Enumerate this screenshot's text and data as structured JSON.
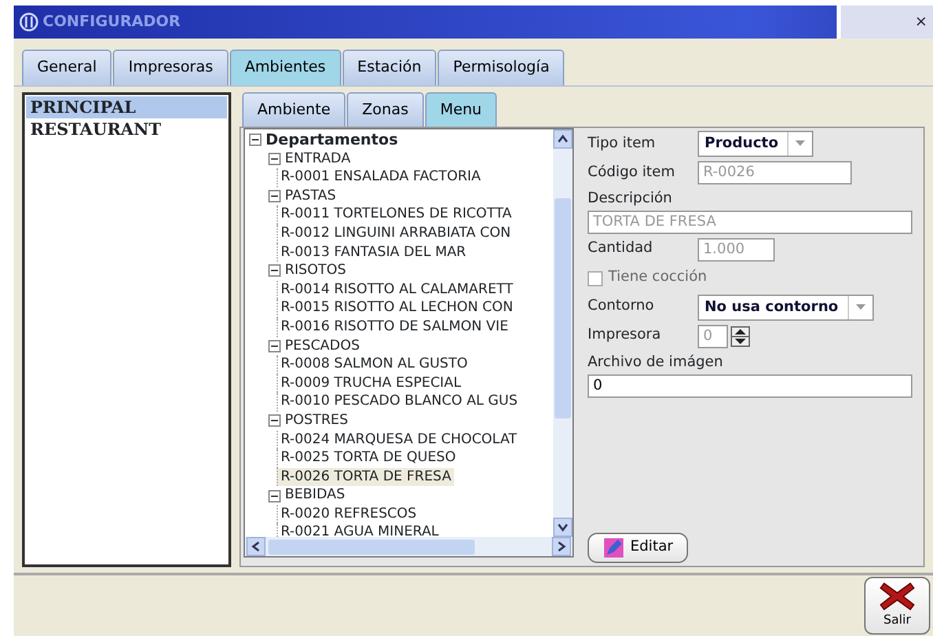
{
  "window": {
    "title": "CONFIGURADOR",
    "close": "×"
  },
  "tabs": [
    {
      "label": "General",
      "selected": false
    },
    {
      "label": "Impresoras",
      "selected": false
    },
    {
      "label": "Ambientes",
      "selected": true
    },
    {
      "label": "Estación",
      "selected": false
    },
    {
      "label": "Permisología",
      "selected": false
    }
  ],
  "ambientes": [
    {
      "label": "PRINCIPAL",
      "selected": true
    },
    {
      "label": "RESTAURANT",
      "selected": false
    }
  ],
  "subtabs": [
    {
      "label": "Ambiente",
      "selected": false
    },
    {
      "label": "Zonas",
      "selected": false
    },
    {
      "label": "Menu",
      "selected": true
    }
  ],
  "tree": {
    "label": "Departamentos",
    "expanded": true,
    "children": [
      {
        "label": "ENTRADA",
        "expanded": true,
        "children": [
          {
            "label": "R-0001 ENSALADA FACTORIA",
            "selected": false
          }
        ]
      },
      {
        "label": "PASTAS",
        "expanded": true,
        "children": [
          {
            "label": "R-0011 TORTELONES DE RICOTTA",
            "selected": false
          },
          {
            "label": "R-0012 LINGUINI ARRABIATA CON",
            "selected": false
          },
          {
            "label": "R-0013 FANTASIA DEL MAR",
            "selected": false
          }
        ]
      },
      {
        "label": "RISOTOS",
        "expanded": true,
        "children": [
          {
            "label": "R-0014 RISOTTO AL CALAMARETT",
            "selected": false
          },
          {
            "label": "R-0015 RISOTTO AL LECHON CON",
            "selected": false
          },
          {
            "label": "R-0016 RISOTTO DE SALMON VIE",
            "selected": false
          }
        ]
      },
      {
        "label": "PESCADOS",
        "expanded": true,
        "children": [
          {
            "label": "R-0008 SALMON AL GUSTO",
            "selected": false
          },
          {
            "label": "R-0009 TRUCHA ESPECIAL",
            "selected": false
          },
          {
            "label": "R-0010 PESCADO BLANCO AL GUS",
            "selected": false
          }
        ]
      },
      {
        "label": "POSTRES",
        "expanded": true,
        "children": [
          {
            "label": "R-0024 MARQUESA DE CHOCOLAT",
            "selected": false
          },
          {
            "label": "R-0025 TORTA DE QUESO",
            "selected": false
          },
          {
            "label": "R-0026 TORTA DE FRESA",
            "selected": true
          }
        ]
      },
      {
        "label": "BEBIDAS",
        "expanded": true,
        "children": [
          {
            "label": "R-0020 REFRESCOS",
            "selected": false
          },
          {
            "label": "R-0021 AGUA MINERAL",
            "selected": false
          }
        ]
      }
    ]
  },
  "form": [
    {
      "kind": "select",
      "label": "Tipo item",
      "value": "Producto"
    },
    {
      "kind": "text",
      "label": "Código item",
      "value": "R-0026",
      "disabled": true
    },
    {
      "kind": "stacked",
      "label": "Descripción",
      "value": "TORTA DE FRESA",
      "disabled": true
    },
    {
      "kind": "text",
      "label": "Cantidad",
      "value": "1.000",
      "disabled": true
    },
    {
      "kind": "checkbox",
      "label": "Tiene cocción",
      "checked": false,
      "disabled": true
    },
    {
      "kind": "select",
      "label": "Contorno",
      "value": "No usa contorno"
    },
    {
      "kind": "spin",
      "label": "Impresora",
      "value": "0",
      "disabled": true
    },
    {
      "kind": "stacked",
      "label": "Archivo de imágen",
      "value": "0",
      "disabled": false
    }
  ],
  "edit_button": "Editar",
  "exit_button": "Salir"
}
